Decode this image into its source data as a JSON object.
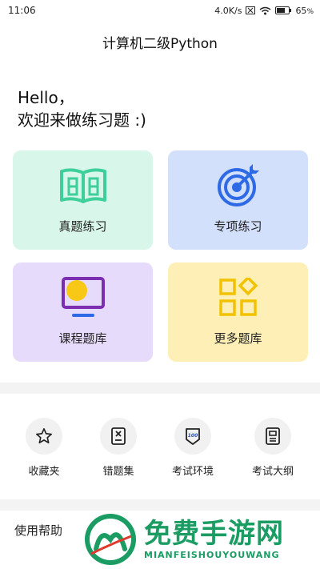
{
  "status_bar": {
    "time": "11:06",
    "net_speed": "4.0K/s",
    "battery": "65"
  },
  "app_bar": {
    "title": "计算机二级Python"
  },
  "greeting": {
    "line1": "Hello，",
    "line2": "欢迎来做练习题 :)"
  },
  "cards": [
    {
      "label": "真题练习",
      "icon": "book-icon",
      "bg": "#d8f6ea",
      "accent": "#3ecf9a"
    },
    {
      "label": "专项练习",
      "icon": "target-icon",
      "bg": "#d3e0fb",
      "accent": "#2e6ae6"
    },
    {
      "label": "课程题库",
      "icon": "monitor-icon",
      "bg": "#e6dbfa",
      "accent": "#7b2fb0"
    },
    {
      "label": "更多题库",
      "icon": "apps-grid-icon",
      "bg": "#fdefb6",
      "accent": "#f2c200"
    }
  ],
  "tools": [
    {
      "label": "收藏夹",
      "icon": "star-icon"
    },
    {
      "label": "错题集",
      "icon": "wrong-paper-icon"
    },
    {
      "label": "考试环境",
      "icon": "score-badge-icon"
    },
    {
      "label": "考试大纲",
      "icon": "outline-doc-icon"
    }
  ],
  "help": {
    "label": "使用帮助"
  },
  "watermark": {
    "title": "免费手游网",
    "subtitle": "MIANFEISHOUYOUWANG",
    "logo_letter": "M"
  }
}
